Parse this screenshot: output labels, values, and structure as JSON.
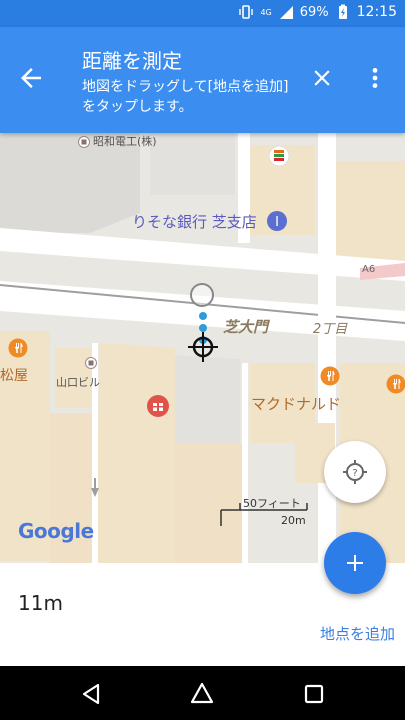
{
  "status_bar": {
    "network": "4G",
    "battery": "69%",
    "time": "12:15"
  },
  "header": {
    "title": "距離を測定",
    "subtitle": "地図をドラッグして[地点を追加]をタップします。"
  },
  "map": {
    "labels": {
      "showa_denko": "昭和電工(株)",
      "resona": "りそな銀行 芝支店",
      "shibadaimon": "芝大門",
      "chome": "2丁目",
      "matsuya": "松屋",
      "yamaguchi": "山口ビル",
      "mcdonalds": "マクドナルド",
      "road_a6": "A6",
      "google": "Google"
    },
    "scale": {
      "feet": "50フィート",
      "meters": "20m"
    },
    "colors": {
      "road": "#ffffff",
      "block": "#e4e1da",
      "building": "#f1e3c8",
      "park_line": "#9e9e9e",
      "measure_dot": "#2d9cdb"
    }
  },
  "measure": {
    "distance": "11m",
    "add_point": "地点を追加"
  },
  "icons": {
    "back": "arrow-back-icon",
    "close": "close-icon",
    "more": "more-vert-icon",
    "locate": "my-location-icon",
    "add": "plus-icon"
  }
}
